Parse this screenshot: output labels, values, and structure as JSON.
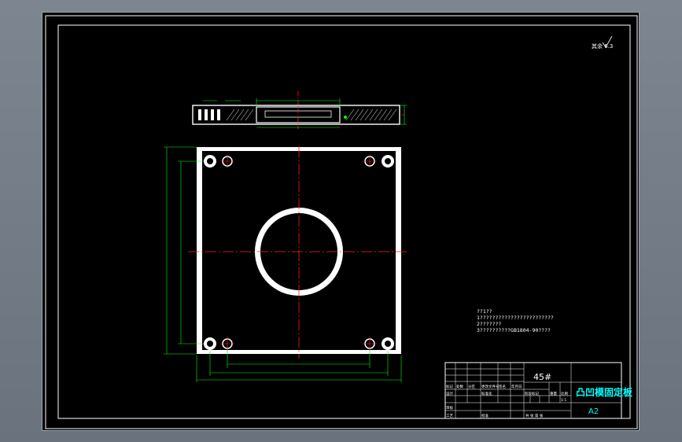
{
  "drawing": {
    "roughness_mark": "其余 6.3",
    "notes": [
      "??1??",
      "1????????????????????????",
      "2???????",
      "3??????????GB1804-90????"
    ]
  },
  "title_block": {
    "material": "45#",
    "part_name": "凸凹模固定板",
    "sheet_size": "A2",
    "labels": {
      "mark": "标记",
      "count": "处数",
      "division": "分区",
      "doc_no": "更改文件号",
      "sign": "签名",
      "date": "年月日",
      "design": "设计",
      "standardize": "标准化",
      "stage_mark": "阶段标记",
      "weight": "重量",
      "scale": "比例",
      "review": "审核",
      "process": "工艺",
      "approve": "批准",
      "sheets": "共 张 第 张"
    },
    "scale_value": "1:1"
  },
  "colors": {
    "background": "#000000",
    "line": "#ffffff",
    "centerline": "#ff2020",
    "dimension": "#00ff00",
    "annotation": "#00ffff"
  }
}
